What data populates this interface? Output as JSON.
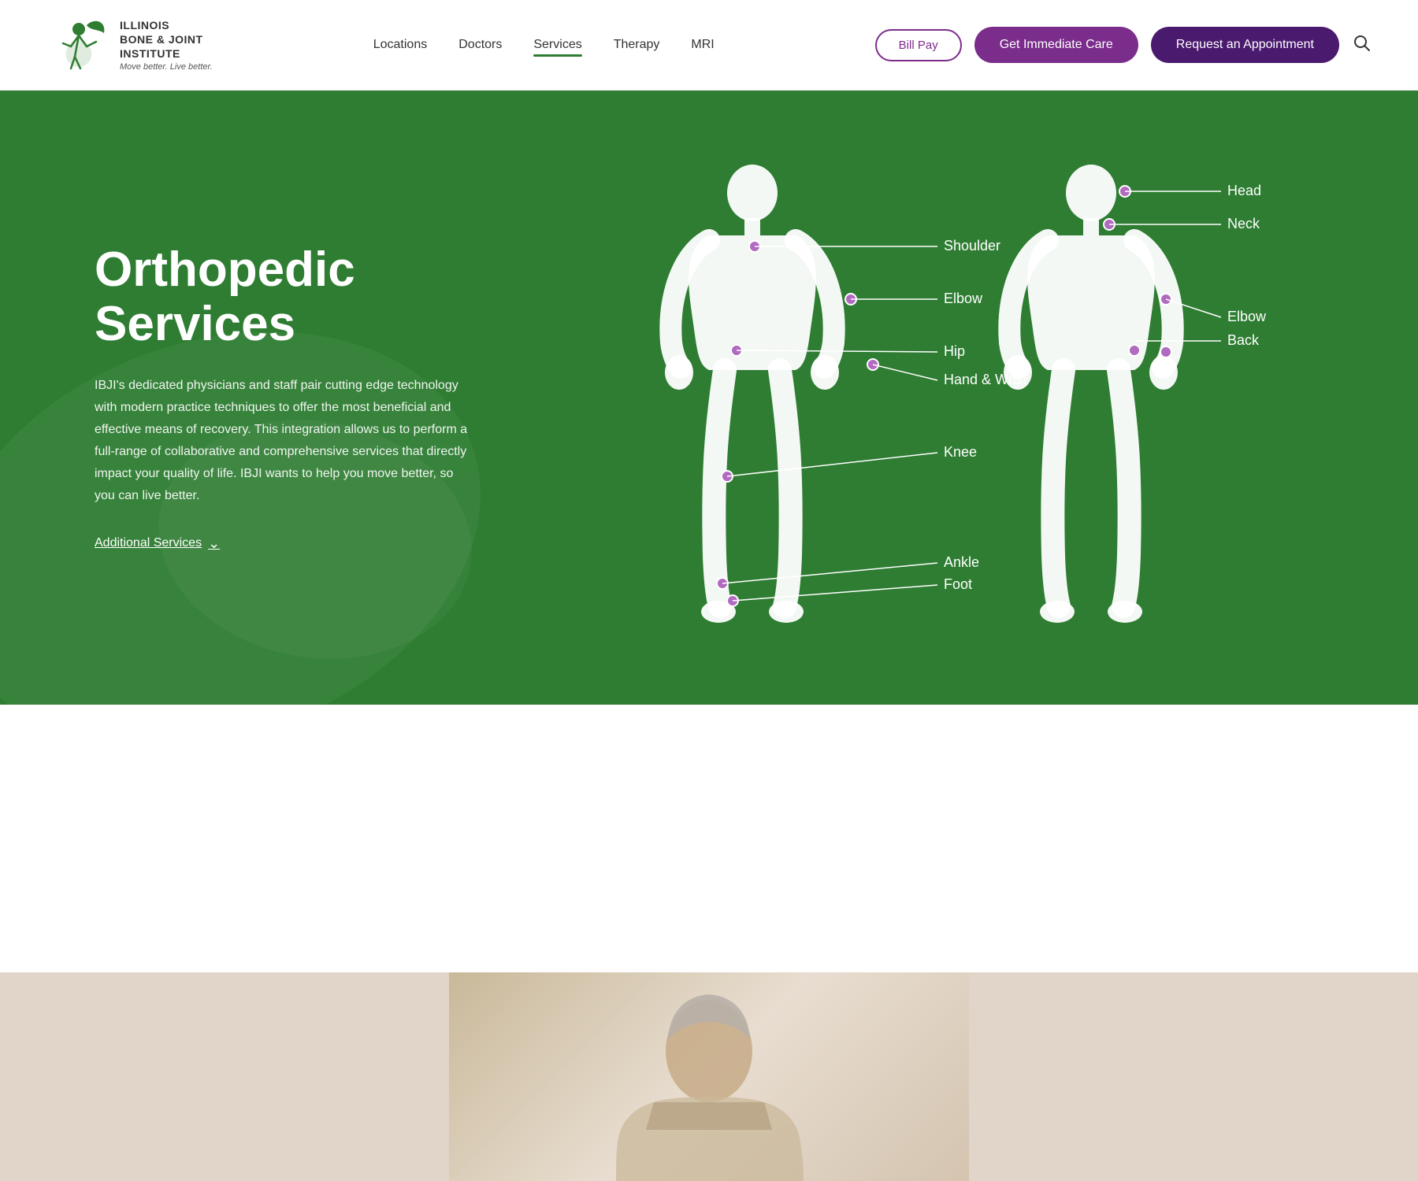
{
  "header": {
    "logo_title": "ILLINOIS\nBONE & JOINT\nINSTITUTE",
    "logo_subtitle": "Move better. Live better.",
    "nav": [
      {
        "label": "Locations",
        "active": false
      },
      {
        "label": "Doctors",
        "active": false
      },
      {
        "label": "Services",
        "active": true
      },
      {
        "label": "Therapy",
        "active": false
      },
      {
        "label": "MRI",
        "active": false
      }
    ],
    "bill_pay_label": "Bill Pay",
    "immediate_care_label": "Get Immediate Care",
    "appointment_label": "Request an Appointment"
  },
  "hero": {
    "title": "Orthopedic Services",
    "description": "IBJI's dedicated physicians and staff pair cutting edge technology with modern practice techniques to offer the most beneficial and effective means of recovery. This integration allows us to perform a full-range of collaborative and comprehensive services that directly impact your quality of life. IBJI wants to help you move better, so you can live better.",
    "additional_services_label": "Additional Services",
    "body_labels": [
      {
        "id": "head",
        "text": "Head"
      },
      {
        "id": "neck",
        "text": "Neck"
      },
      {
        "id": "shoulder",
        "text": "Shoulder"
      },
      {
        "id": "elbow",
        "text": "Elbow"
      },
      {
        "id": "back",
        "text": "Back"
      },
      {
        "id": "hip",
        "text": "Hip"
      },
      {
        "id": "hand_wrist",
        "text": "Hand & Wrist"
      },
      {
        "id": "knee",
        "text": "Knee"
      },
      {
        "id": "ankle",
        "text": "Ankle"
      },
      {
        "id": "foot",
        "text": "Foot"
      }
    ]
  },
  "colors": {
    "green": "#2e7d32",
    "purple": "#7b2d8b",
    "dark_purple": "#4a1a6e",
    "white": "#ffffff",
    "dot_color": "#b06abf"
  }
}
